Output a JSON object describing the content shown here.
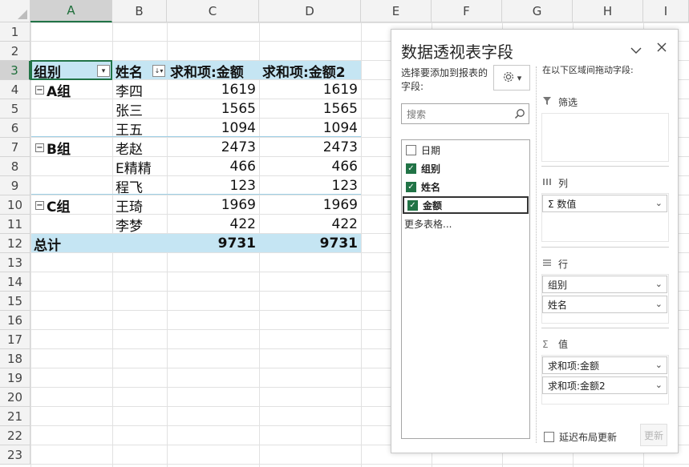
{
  "columns": [
    "A",
    "B",
    "C",
    "D",
    "E",
    "F",
    "G",
    "H",
    "I"
  ],
  "rows": [
    "1",
    "2",
    "3",
    "4",
    "5",
    "6",
    "7",
    "8",
    "9",
    "10",
    "11",
    "12",
    "13",
    "14",
    "15",
    "16",
    "17",
    "18",
    "19",
    "20",
    "21",
    "22",
    "23"
  ],
  "pivot": {
    "header": {
      "group": "组别",
      "name": "姓名",
      "sum1": "求和项:金额",
      "sum2": "求和项:金额2"
    },
    "body": [
      {
        "group": "A组",
        "name": "李四",
        "v1": "1619",
        "v2": "1619"
      },
      {
        "group": "",
        "name": "张三",
        "v1": "1565",
        "v2": "1565"
      },
      {
        "group": "",
        "name": "王五",
        "v1": "1094",
        "v2": "1094"
      },
      {
        "group": "B组",
        "name": "老赵",
        "v1": "2473",
        "v2": "2473"
      },
      {
        "group": "",
        "name": "E精精",
        "v1": "466",
        "v2": "466"
      },
      {
        "group": "",
        "name": "程飞",
        "v1": "123",
        "v2": "123"
      },
      {
        "group": "C组",
        "name": "王琦",
        "v1": "1969",
        "v2": "1969"
      },
      {
        "group": "",
        "name": "李梦",
        "v1": "422",
        "v2": "422"
      }
    ],
    "total": {
      "label": "总计",
      "v1": "9731",
      "v2": "9731"
    },
    "collapse_symbol": "−"
  },
  "panel": {
    "title": "数据透视表字段",
    "choose_label": "选择要添加到报表的字段:",
    "search_placeholder": "搜索",
    "fields": [
      {
        "label": "日期",
        "checked": false
      },
      {
        "label": "组别",
        "checked": true
      },
      {
        "label": "姓名",
        "checked": true
      },
      {
        "label": "金额",
        "checked": true
      }
    ],
    "more_tables": "更多表格...",
    "drag_label": "在以下区域间拖动字段:",
    "areas": {
      "filter": "筛选",
      "columns": "列",
      "rows": "行",
      "values": "值"
    },
    "columns_items": [
      "Σ 数值"
    ],
    "rows_items": [
      "组别",
      "姓名"
    ],
    "values_items": [
      "求和项:金额",
      "求和项:金额2"
    ],
    "defer_label": "延迟布局更新",
    "update_label": "更新"
  },
  "colors": {
    "accent": "#217346",
    "pivot_band": "#c5e5f3"
  }
}
